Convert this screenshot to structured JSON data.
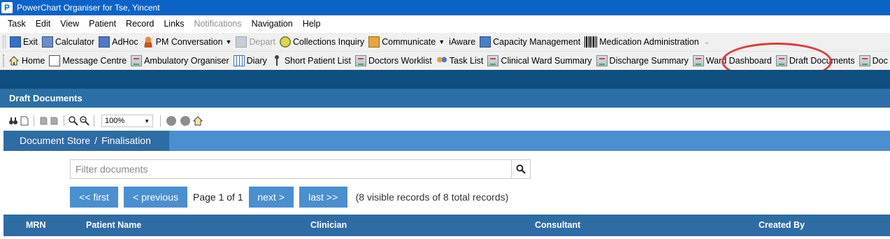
{
  "window": {
    "title": "PowerChart Organiser for Tse, Yincent",
    "app_icon_letter": "P"
  },
  "menu": [
    {
      "label": "Task",
      "disabled": false
    },
    {
      "label": "Edit",
      "disabled": false
    },
    {
      "label": "View",
      "disabled": false
    },
    {
      "label": "Patient",
      "disabled": false
    },
    {
      "label": "Record",
      "disabled": false
    },
    {
      "label": "Links",
      "disabled": false
    },
    {
      "label": "Notifications",
      "disabled": true
    },
    {
      "label": "Navigation",
      "disabled": false
    },
    {
      "label": "Help",
      "disabled": false
    }
  ],
  "toolbar1": {
    "exit": "Exit",
    "calculator": "Calculator",
    "adhoc": "AdHoc",
    "pm_conversation": "PM Conversation",
    "depart": "Depart",
    "collections_inquiry": "Collections Inquiry",
    "communicate": "Communicate",
    "iaware": "iAware",
    "capacity_management": "Capacity Management",
    "medication_administration": "Medication Administration"
  },
  "toolbar2": {
    "home": "Home",
    "message_centre": "Message Centre",
    "ambulatory_organiser": "Ambulatory Organiser",
    "diary": "Diary",
    "short_patient_list": "Short Patient List",
    "doctors_worklist": "Doctors Worklist",
    "task_list": "Task List",
    "clinical_ward_summary": "Clinical Ward Summary",
    "discharge_summary": "Discharge Summary",
    "ward_dashboard": "Ward Dashboard",
    "draft_documents": "Draft Documents",
    "doc_signing": "Doc Signing"
  },
  "section": {
    "title": "Draft Documents"
  },
  "viewer": {
    "zoom": "100%"
  },
  "breadcrumb": {
    "root": "Document Store",
    "separator": "/",
    "current": "Finalisation"
  },
  "filter": {
    "placeholder": "Filter documents"
  },
  "pager": {
    "first": "<< first",
    "previous": "< previous",
    "page_info": "Page 1 of 1",
    "next": "next >",
    "last": "last >>",
    "records": "(8 visible records of 8 total records)"
  },
  "table": {
    "columns": [
      "MRN",
      "Patient Name",
      "Clinician",
      "Consultant",
      "Created By"
    ]
  },
  "colors": {
    "title_bar": "#0a64c8",
    "header_dark": "#0e4f80",
    "section_header": "#2b6fa6",
    "accent_blue": "#4a8fd0",
    "annotation_red": "#e0393e"
  }
}
